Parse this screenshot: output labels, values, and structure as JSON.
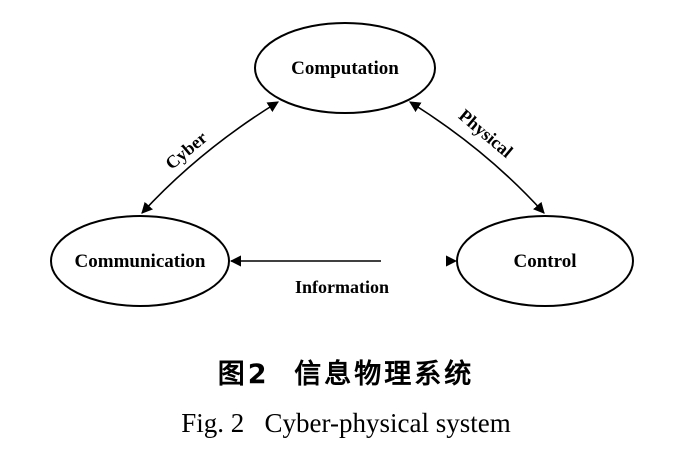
{
  "diagram": {
    "nodes": {
      "computation": "Computation",
      "communication": "Communication",
      "control": "Control"
    },
    "edges": {
      "cyber": "Cyber",
      "physical": "Physical",
      "information": "Information"
    }
  },
  "caption": {
    "chinese": "图2  信息物理系统",
    "english": "Fig. 2   Cyber-physical system"
  }
}
